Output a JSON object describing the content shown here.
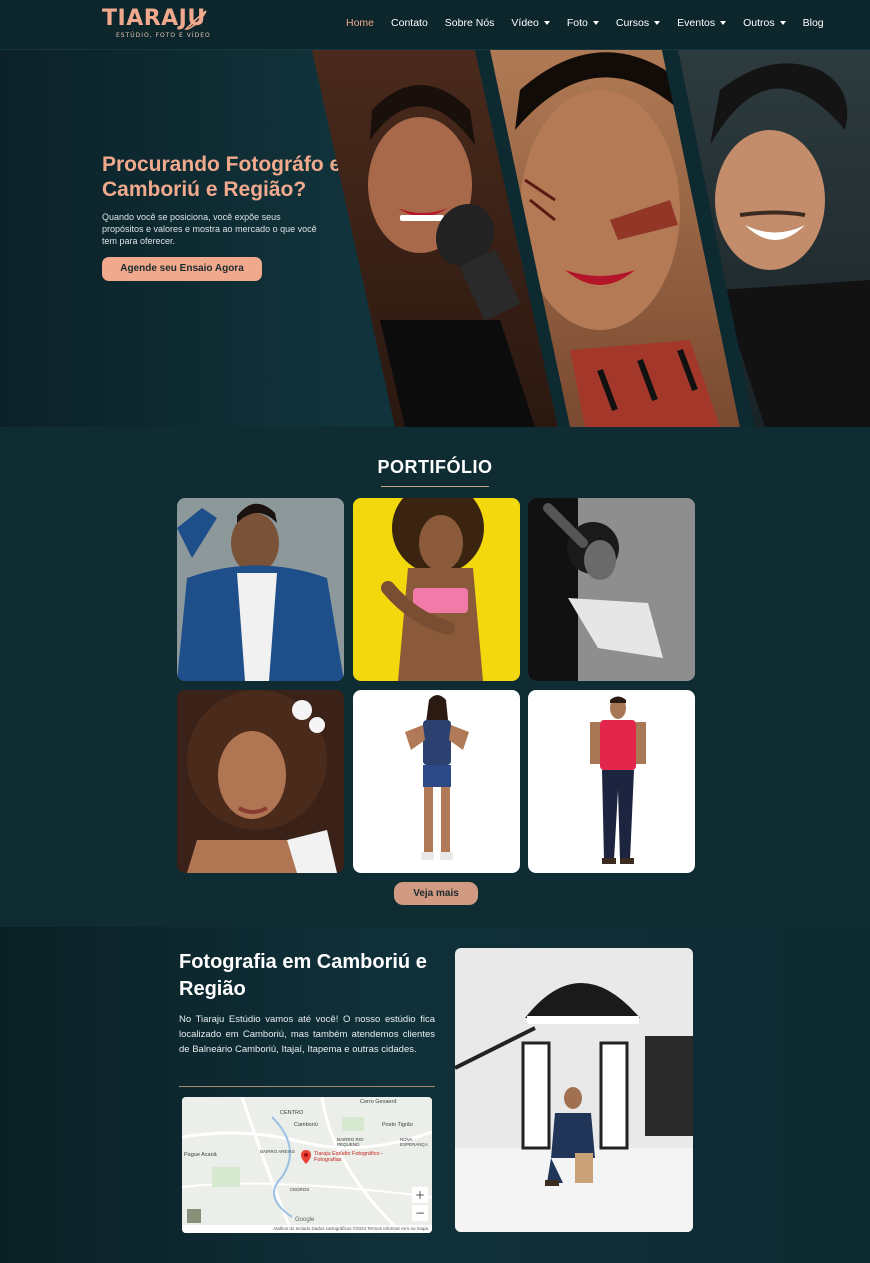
{
  "brand": {
    "name": "TIARAJU",
    "tagline": "ESTÚDIO, FOTO E VÍDEO",
    "accent": "#f0a98c"
  },
  "nav": {
    "items": [
      {
        "label": "Home",
        "dropdown": false,
        "active": true
      },
      {
        "label": "Contato",
        "dropdown": false
      },
      {
        "label": "Sobre Nós",
        "dropdown": false
      },
      {
        "label": "Vídeo",
        "dropdown": true
      },
      {
        "label": "Foto",
        "dropdown": true
      },
      {
        "label": "Cursos",
        "dropdown": true
      },
      {
        "label": "Eventos",
        "dropdown": true
      },
      {
        "label": "Outros",
        "dropdown": true
      },
      {
        "label": "Blog",
        "dropdown": false
      }
    ]
  },
  "hero": {
    "title": "Procurando Fotográfo em Camboriú e Região?",
    "text": "Quando você se posiciona, você expõe seus propósitos e valores e mostra ao mercado o que você tem para oferecer.",
    "cta": "Agende seu Ensaio Agora"
  },
  "portfolio": {
    "title": "PORTIFÓLIO",
    "see_more": "Veja mais"
  },
  "location": {
    "title": "Fotografia em Camboriú e Região",
    "text": "No Tiaraju Estúdio vamos até você! O nosso estúdio fica localizado em Camboriú, mas também atendemos clientes de Balneário Camboriú, Itajaí, Itapema e outras cidades.",
    "map": {
      "labels": {
        "centro": "CENTRO",
        "camboriu": "Camboriú",
        "cerro": "Cerro Gevaerd",
        "rio_pequeno": "BAIRRO RIO PEQUENO",
        "nova": "NOVA ESPERANÇA",
        "areias": "BAIRRO AREIAS",
        "pague": "Pague Acanâ",
        "tigrao": "Posto Tigrão",
        "cedros": "CEDROS",
        "pin": "Tiaraju Estúdio Fotográfico - Fotografias"
      },
      "zoom_in": "+",
      "zoom_out": "−",
      "footer": "Atalhos do teclado   Dados cartográficos ©2024   Termos   Informar erro no mapa",
      "google": "Google"
    }
  }
}
